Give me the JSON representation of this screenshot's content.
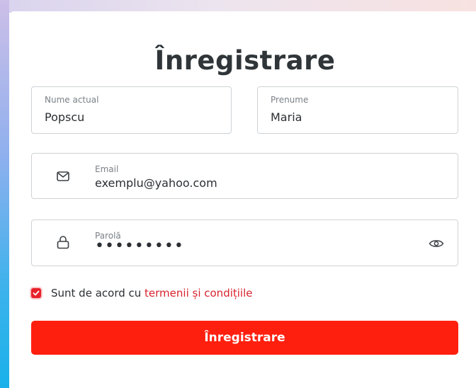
{
  "form": {
    "title": "Înregistrare",
    "last_name": {
      "label": "Nume actual",
      "value": "Popscu"
    },
    "first_name": {
      "label": "Prenume",
      "value": "Maria"
    },
    "email": {
      "label": "Email",
      "value": "exemplu@yahoo.com",
      "icon": "mail-icon"
    },
    "password": {
      "label": "Parolă",
      "value": "•••••••••",
      "icon": "lock-icon",
      "toggle_icon": "eye-icon"
    },
    "terms": {
      "checked": true,
      "prefix": "Sunt de acord cu ",
      "link": "termenii și condițiile"
    },
    "submit_label": "Înregistrare"
  },
  "colors": {
    "accent": "#ff1f0f",
    "link": "#d8232e",
    "title": "#2f3538",
    "border": "#cfd3d7"
  }
}
